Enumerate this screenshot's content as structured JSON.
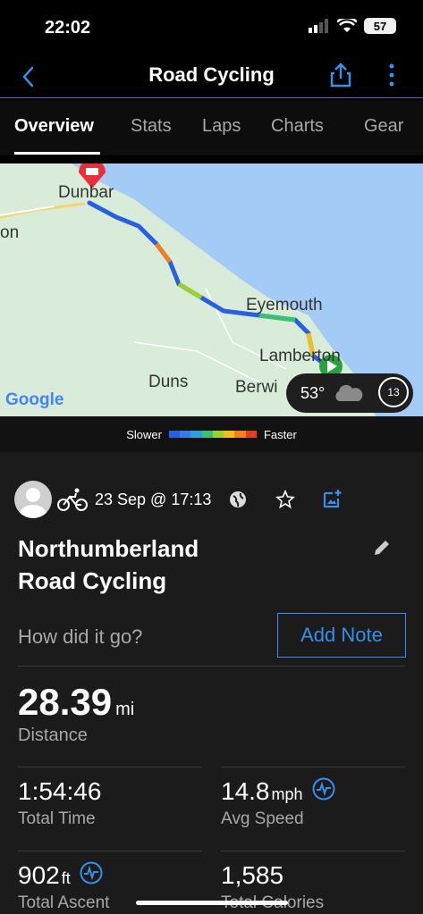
{
  "status": {
    "time": "22:02",
    "battery": "57"
  },
  "nav": {
    "title": "Road Cycling"
  },
  "tabs": [
    "Overview",
    "Stats",
    "Laps",
    "Charts",
    "Gear"
  ],
  "map": {
    "places": [
      "Dunbar",
      "on",
      "Eyemouth",
      "Lamberton",
      "Duns",
      "Berwi"
    ],
    "google": "Google",
    "weather_temp": "53°",
    "wind": "13"
  },
  "legend": {
    "slower": "Slower",
    "faster": "Faster",
    "colors": [
      "#2a5fe0",
      "#3a7ae8",
      "#2aa0e0",
      "#3ac070",
      "#9ad030",
      "#f0c020",
      "#f08020",
      "#e04020"
    ]
  },
  "activity": {
    "date": "23 Sep @ 17:13",
    "title_line1": "Northumberland",
    "title_line2": "Road Cycling",
    "prompt": "How did it go?",
    "add_note": "Add Note"
  },
  "stats": {
    "distance": {
      "value": "28.39",
      "unit": "mi",
      "label": "Distance"
    },
    "total_time": {
      "value": "1:54:46",
      "label": "Total Time"
    },
    "avg_speed": {
      "value": "14.8",
      "unit": "mph",
      "label": "Avg Speed"
    },
    "total_ascent": {
      "value": "902",
      "unit": "ft",
      "label": "Total Ascent"
    },
    "total_calories": {
      "value": "1,585",
      "label": "Total Calories"
    }
  }
}
